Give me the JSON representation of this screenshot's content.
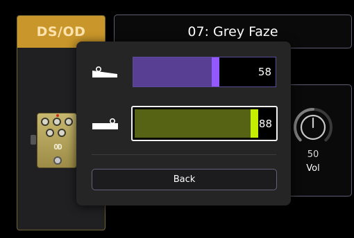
{
  "effect_card": {
    "category_label": "DS/OD",
    "pedal_model_label": "OD"
  },
  "preset": {
    "name": "07: Grey Faze"
  },
  "parameter": {
    "value": "50",
    "label": "Vol",
    "knob_level": 0.5
  },
  "modal": {
    "expression_1": {
      "icon": "expression-pedal-heel-icon",
      "value": "58",
      "level": 0.58,
      "color": "#9359ff"
    },
    "expression_2": {
      "icon": "expression-pedal-toe-icon",
      "value": "88",
      "level": 0.88,
      "color": "#c6ee00"
    },
    "back_label": "Back"
  }
}
